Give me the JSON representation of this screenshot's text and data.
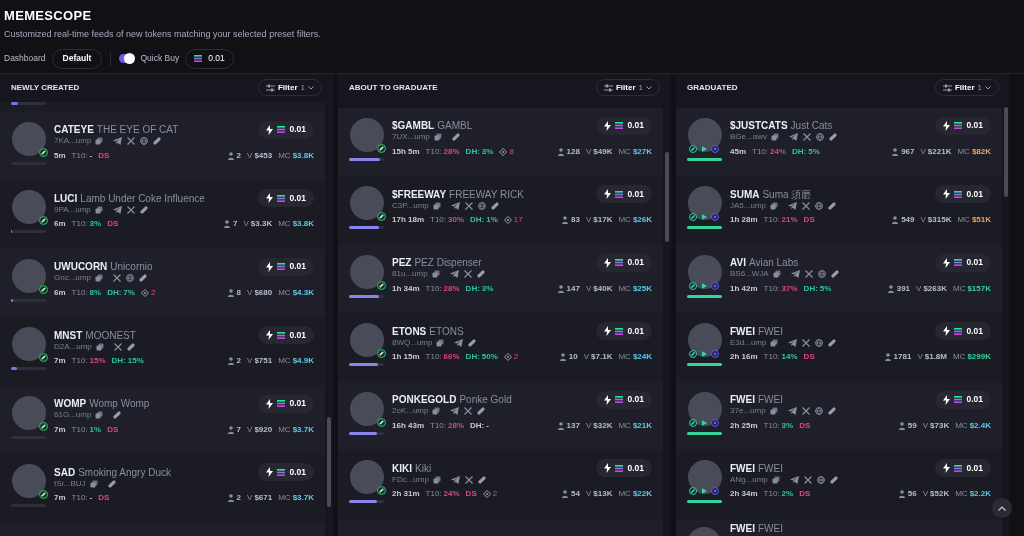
{
  "title": "MEMESCOPE",
  "subtitle": "Customized real-time feeds of new tokens matching your selected preset filters.",
  "dashboard": {
    "label": "Dashboard",
    "preset": "Default"
  },
  "quick_buy": {
    "label": "Quick Buy",
    "on": true,
    "amount": "0.01"
  },
  "columns": [
    {
      "kind": "new",
      "title": "NEWLY CREATED",
      "filter_label": "Filter",
      "filter_count": "1",
      "top_stub": {
        "level": 0.2
      },
      "cards": [
        {
          "ticker": "CATEYE",
          "name": "THE EYE OF CAT",
          "address": "7KA...ump",
          "links": [
            {
              "kind": "telegram"
            },
            {
              "kind": "x"
            },
            {
              "kind": "web"
            },
            {
              "kind": "pill"
            }
          ],
          "age": "5m",
          "badges": [
            {
              "kind": "t10",
              "label": "T10:",
              "value": "-"
            },
            {
              "kind": "ds",
              "value": "DS"
            }
          ],
          "holders": "2",
          "volume_label": "V",
          "volume": "$453",
          "mc": {
            "kind": "small",
            "label": "MC",
            "value": "$3.8K"
          },
          "level": 0,
          "buy": "0.01"
        },
        {
          "ticker": "LUCI",
          "name": "Lamb Under Coke Influence",
          "address": "9PA...ump",
          "links": [
            {
              "kind": "telegram"
            },
            {
              "kind": "x"
            },
            {
              "kind": "pill"
            }
          ],
          "age": "6m",
          "badges": [
            {
              "kind": "t10",
              "label": "T10:",
              "value": "3%",
              "warning": false
            },
            {
              "kind": "ds",
              "value": "DS"
            }
          ],
          "holders": "7",
          "volume_label": "V",
          "volume": "$3.3K",
          "mc": {
            "kind": "small",
            "label": "MC",
            "value": "$3.8K"
          },
          "level": 0.02,
          "buy": "0.01"
        },
        {
          "ticker": "UWUCORN",
          "name": "Unicornio",
          "address": "Gnc...ump",
          "links": [
            {
              "kind": "x"
            },
            {
              "kind": "web"
            },
            {
              "kind": "pill"
            }
          ],
          "age": "6m",
          "badges": [
            {
              "kind": "t10",
              "label": "T10:",
              "value": "8%",
              "warning": false
            },
            {
              "kind": "dh",
              "label": "DH:",
              "value": "7%",
              "warning": false
            },
            {
              "kind": "snipers",
              "value": "2"
            }
          ],
          "holders": "8",
          "volume_label": "V",
          "volume": "$680",
          "mc": {
            "kind": "small",
            "label": "MC",
            "value": "$4.3K"
          },
          "level": 0.06,
          "buy": "0.01"
        },
        {
          "ticker": "MNST",
          "name": "MOONEST",
          "address": "D2A...ump",
          "links": [
            {
              "kind": "x"
            },
            {
              "kind": "pill"
            }
          ],
          "age": "7m",
          "badges": [
            {
              "kind": "t10",
              "label": "T10:",
              "value": "15%",
              "warning": true
            },
            {
              "kind": "dh",
              "label": "DH:",
              "value": "15%",
              "warning": false
            }
          ],
          "holders": "2",
          "volume_label": "V",
          "volume": "$751",
          "mc": {
            "kind": "small",
            "label": "MC",
            "value": "$4.9K"
          },
          "level": 0.18,
          "buy": "0.01"
        },
        {
          "ticker": "WOMP",
          "name": "Womp Womp",
          "address": "61G...ump",
          "links": [
            {
              "kind": "pill"
            }
          ],
          "age": "7m",
          "badges": [
            {
              "kind": "t10",
              "label": "T10:",
              "value": "1%",
              "warning": false
            },
            {
              "kind": "ds",
              "value": "DS"
            }
          ],
          "holders": "7",
          "volume_label": "V",
          "volume": "$920",
          "mc": {
            "kind": "small",
            "label": "MC",
            "value": "$3.7K"
          },
          "level": 0,
          "buy": "0.01"
        },
        {
          "ticker": "SAD",
          "name": "Smoking Angry Duck",
          "address": "tSr...BUJ",
          "links": [
            {
              "kind": "pill"
            }
          ],
          "age": "7m",
          "badges": [
            {
              "kind": "t10",
              "label": "T10:",
              "value": "-"
            },
            {
              "kind": "ds",
              "value": "DS"
            }
          ],
          "holders": "2",
          "volume_label": "V",
          "volume": "$671",
          "mc": {
            "kind": "small",
            "label": "MC",
            "value": "$3.7K"
          },
          "level": 0,
          "buy": "0.01"
        }
      ]
    },
    {
      "kind": "graduating",
      "title": "ABOUT TO GRADUATE",
      "filter_label": "Filter",
      "filter_count": "1",
      "cards": [
        {
          "ticker": "$GAMBL",
          "name": "GAMBL",
          "address": "7UX...ump",
          "links": [
            {
              "kind": "pill"
            }
          ],
          "age": "15h 5m",
          "badges": [
            {
              "kind": "t10",
              "label": "T10:",
              "value": "28%",
              "warning": true
            },
            {
              "kind": "dh",
              "label": "DH:",
              "value": "3%",
              "warning": false
            },
            {
              "kind": "snipers",
              "value": "8"
            }
          ],
          "holders": "128",
          "volume_label": "V",
          "volume": "$49K",
          "mc": {
            "kind": "small",
            "label": "MC",
            "value": "$27K"
          },
          "level": 0.88,
          "buy": "0.01"
        },
        {
          "ticker": "$FREEWAY",
          "name": "FREEWAY RICK",
          "address": "C3P...ump",
          "links": [
            {
              "kind": "telegram"
            },
            {
              "kind": "x"
            },
            {
              "kind": "web"
            },
            {
              "kind": "pill"
            }
          ],
          "age": "17h 18m",
          "badges": [
            {
              "kind": "t10",
              "label": "T10:",
              "value": "30%",
              "warning": true
            },
            {
              "kind": "dh",
              "label": "DH:",
              "value": "1%",
              "warning": false
            },
            {
              "kind": "snipers",
              "value": "17"
            }
          ],
          "holders": "83",
          "volume_label": "V",
          "volume": "$17K",
          "mc": {
            "kind": "small",
            "label": "MC",
            "value": "$26K"
          },
          "level": 0.87,
          "buy": "0.01"
        },
        {
          "ticker": "PEZ",
          "name": "PEZ Dispenser",
          "address": "81u...ump",
          "links": [
            {
              "kind": "telegram"
            },
            {
              "kind": "x"
            },
            {
              "kind": "pill"
            }
          ],
          "age": "1h 34m",
          "badges": [
            {
              "kind": "t10",
              "label": "T10:",
              "value": "28%",
              "warning": true
            },
            {
              "kind": "dh",
              "label": "DH:",
              "value": "3%",
              "warning": false
            }
          ],
          "holders": "147",
          "volume_label": "V",
          "volume": "$40K",
          "mc": {
            "kind": "small",
            "label": "MC",
            "value": "$25K"
          },
          "level": 0.85,
          "buy": "0.01"
        },
        {
          "ticker": "ETONS",
          "name": "ETONS",
          "address": "8WQ...ump",
          "links": [
            {
              "kind": "telegram"
            },
            {
              "kind": "pill"
            }
          ],
          "age": "1h 15m",
          "badges": [
            {
              "kind": "t10",
              "label": "T10:",
              "value": "66%",
              "warning": true
            },
            {
              "kind": "dh",
              "label": "DH:",
              "value": "50%",
              "warning": false
            },
            {
              "kind": "snipers",
              "value": "2"
            }
          ],
          "holders": "10",
          "volume_label": "V",
          "volume": "$7.1K",
          "mc": {
            "kind": "small",
            "label": "MC",
            "value": "$24K"
          },
          "level": 0.84,
          "buy": "0.01"
        },
        {
          "ticker": "PONKEGOLD",
          "name": "Ponke Gold",
          "address": "2oK...ump",
          "links": [
            {
              "kind": "telegram"
            },
            {
              "kind": "x"
            },
            {
              "kind": "pill"
            }
          ],
          "age": "16h 43m",
          "badges": [
            {
              "kind": "t10",
              "label": "T10:",
              "value": "28%",
              "warning": true
            },
            {
              "kind": "dh",
              "label": "DH:",
              "value": "-"
            }
          ],
          "holders": "137",
          "volume_label": "V",
          "volume": "$32K",
          "mc": {
            "kind": "small",
            "label": "MC",
            "value": "$21K"
          },
          "level": 0.8,
          "buy": "0.01"
        },
        {
          "ticker": "KIKI",
          "name": "Kiki",
          "address": "FDc...ump",
          "links": [
            {
              "kind": "telegram"
            },
            {
              "kind": "x"
            },
            {
              "kind": "pill"
            }
          ],
          "age": "2h 31m",
          "badges": [
            {
              "kind": "t10",
              "label": "T10:",
              "value": "24%",
              "warning": true
            },
            {
              "kind": "ds",
              "value": "DS"
            },
            {
              "kind": "snipers",
              "value": "2"
            }
          ],
          "holders": "54",
          "volume_label": "V",
          "volume": "$13K",
          "mc": {
            "kind": "small",
            "label": "MC",
            "value": "$22K"
          },
          "level": 0.8,
          "buy": "0.01"
        }
      ]
    },
    {
      "kind": "graduated",
      "title": "GRADUATED",
      "filter_label": "Filter",
      "filter_count": "1",
      "cards": [
        {
          "ticker": "$JUSTCATS",
          "name": "Just Cats",
          "address": "BGe...awv",
          "links": [
            {
              "kind": "telegram"
            },
            {
              "kind": "x"
            },
            {
              "kind": "web"
            },
            {
              "kind": "pill"
            }
          ],
          "age": "45m",
          "badges": [
            {
              "kind": "t10",
              "label": "T10:",
              "value": "24%",
              "warning": true
            },
            {
              "kind": "dh",
              "label": "DH:",
              "value": "5%",
              "warning": false
            }
          ],
          "holders": "967",
          "volume_label": "V",
          "volume": "$221K",
          "mc": {
            "kind": "medium",
            "label": "MC",
            "value": "$82K"
          },
          "level": 1,
          "buy": "0.01"
        },
        {
          "ticker": "SUMA",
          "name": "Suma 須磨",
          "address": "JA5...ump",
          "links": [
            {
              "kind": "telegram"
            },
            {
              "kind": "x"
            },
            {
              "kind": "web"
            },
            {
              "kind": "pill"
            }
          ],
          "age": "1h 28m",
          "badges": [
            {
              "kind": "t10",
              "label": "T10:",
              "value": "21%",
              "warning": true
            },
            {
              "kind": "ds",
              "value": "DS"
            }
          ],
          "holders": "549",
          "volume_label": "V",
          "volume": "$315K",
          "mc": {
            "kind": "medium",
            "label": "MC",
            "value": "$51K"
          },
          "level": 1,
          "buy": "0.01"
        },
        {
          "ticker": "AVI",
          "name": "Avian Labs",
          "address": "BS6...WJA",
          "links": [
            {
              "kind": "telegram"
            },
            {
              "kind": "x"
            },
            {
              "kind": "web"
            },
            {
              "kind": "pill"
            }
          ],
          "age": "1h 42m",
          "badges": [
            {
              "kind": "t10",
              "label": "T10:",
              "value": "37%",
              "warning": true
            },
            {
              "kind": "dh",
              "label": "DH:",
              "value": "5%",
              "warning": false
            }
          ],
          "holders": "391",
          "volume_label": "V",
          "volume": "$263K",
          "mc": {
            "kind": "large",
            "label": "MC",
            "value": "$157K"
          },
          "level": 1,
          "buy": "0.01"
        },
        {
          "ticker": "FWEI",
          "name": "FWEI",
          "address": "E3d...ump",
          "links": [
            {
              "kind": "telegram"
            },
            {
              "kind": "x"
            },
            {
              "kind": "web"
            },
            {
              "kind": "pill"
            }
          ],
          "age": "2h 16m",
          "badges": [
            {
              "kind": "t10",
              "label": "T10:",
              "value": "14%",
              "warning": false
            },
            {
              "kind": "ds",
              "value": "DS"
            }
          ],
          "holders": "1781",
          "volume_label": "V",
          "volume": "$1.8M",
          "mc": {
            "kind": "large",
            "label": "MC",
            "value": "$299K"
          },
          "level": 1,
          "buy": "0.01"
        },
        {
          "ticker": "FWEI",
          "name": "FWEI",
          "address": "37e...ump",
          "links": [
            {
              "kind": "telegram"
            },
            {
              "kind": "x"
            },
            {
              "kind": "web"
            },
            {
              "kind": "pill"
            }
          ],
          "age": "2h 25m",
          "badges": [
            {
              "kind": "t10",
              "label": "T10:",
              "value": "3%",
              "warning": false
            },
            {
              "kind": "ds",
              "value": "DS"
            }
          ],
          "holders": "59",
          "volume_label": "V",
          "volume": "$73K",
          "mc": {
            "kind": "small",
            "label": "MC",
            "value": "$2.4K"
          },
          "level": 1,
          "buy": "0.01"
        },
        {
          "ticker": "FWEI",
          "name": "FWEI",
          "address": "ANg...ump",
          "links": [
            {
              "kind": "telegram"
            },
            {
              "kind": "x"
            },
            {
              "kind": "web"
            },
            {
              "kind": "pill"
            }
          ],
          "age": "2h 34m",
          "badges": [
            {
              "kind": "t10",
              "label": "T10:",
              "value": "2%",
              "warning": false
            },
            {
              "kind": "ds",
              "value": "DS"
            }
          ],
          "holders": "56",
          "volume_label": "V",
          "volume": "$52K",
          "mc": {
            "kind": "small",
            "label": "MC",
            "value": "$2.2K"
          },
          "level": 1,
          "buy": "0.01"
        }
      ],
      "partial": {
        "ticker": "FWEI",
        "name": "FWEI"
      }
    }
  ]
}
